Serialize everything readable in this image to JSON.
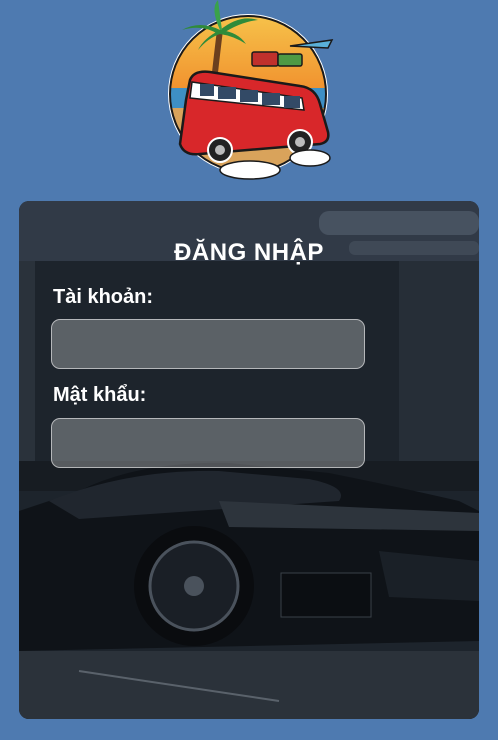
{
  "logo": {
    "icon": "vintage-van-sunset-logo"
  },
  "login": {
    "title": "ĐĂNG NHẬP",
    "username_label": "Tài khoản:",
    "username_value": "",
    "password_label": "Mật khẩu:",
    "password_value": ""
  },
  "background": {
    "icon": "sports-car-garage-photo"
  },
  "colors": {
    "page_background": "#4e7ab0",
    "card_background": "#1f262f",
    "text": "#ffffff"
  }
}
